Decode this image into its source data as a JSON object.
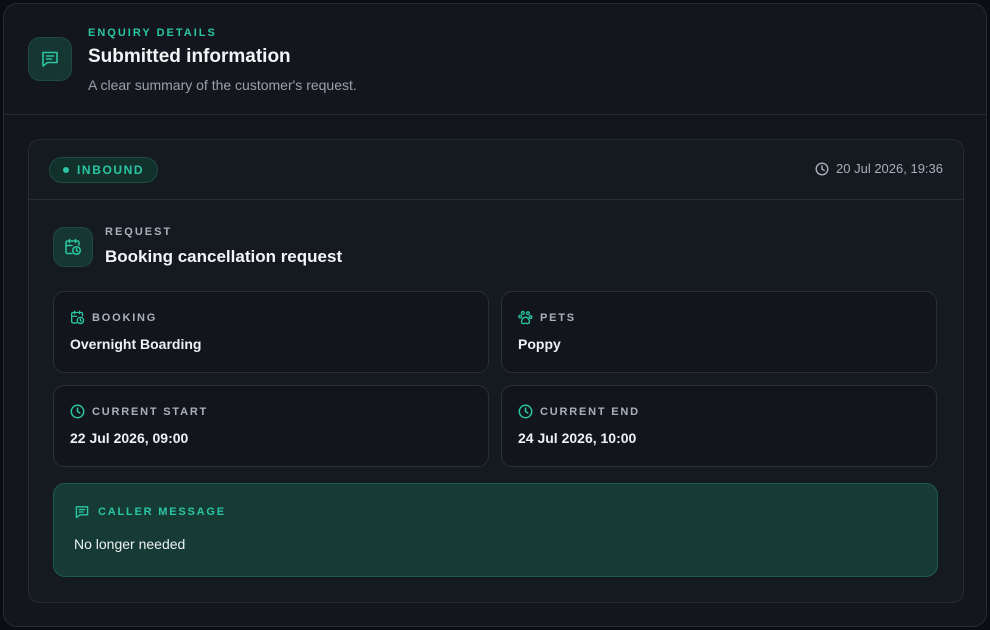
{
  "header": {
    "eyebrow": "ENQUIRY DETAILS",
    "title": "Submitted information",
    "subtitle": "A clear summary of the customer's request."
  },
  "enquiry": {
    "direction": "INBOUND",
    "timestamp": "20 Jul 2026, 19:36",
    "request_label": "REQUEST",
    "request_title": "Booking cancellation request"
  },
  "fields": {
    "booking": {
      "label": "BOOKING",
      "value": "Overnight Boarding"
    },
    "pets": {
      "label": "PETS",
      "value": "Poppy"
    },
    "current_start": {
      "label": "CURRENT START",
      "value": "22 Jul 2026, 09:00"
    },
    "current_end": {
      "label": "CURRENT END",
      "value": "24 Jul 2026, 10:00"
    }
  },
  "message": {
    "label": "CALLER MESSAGE",
    "value": "No longer needed"
  },
  "icons": {
    "header": "message-lines-icon",
    "timestamp": "clock-icon",
    "request": "calendar-clock-icon",
    "booking": "calendar-clock-icon",
    "pets": "paw-icon",
    "current_start": "clock-icon",
    "current_end": "clock-icon",
    "message": "message-lines-icon"
  },
  "colors": {
    "accent": "#2ac6a3",
    "background": "#13161c",
    "message_background": "#163b35"
  }
}
